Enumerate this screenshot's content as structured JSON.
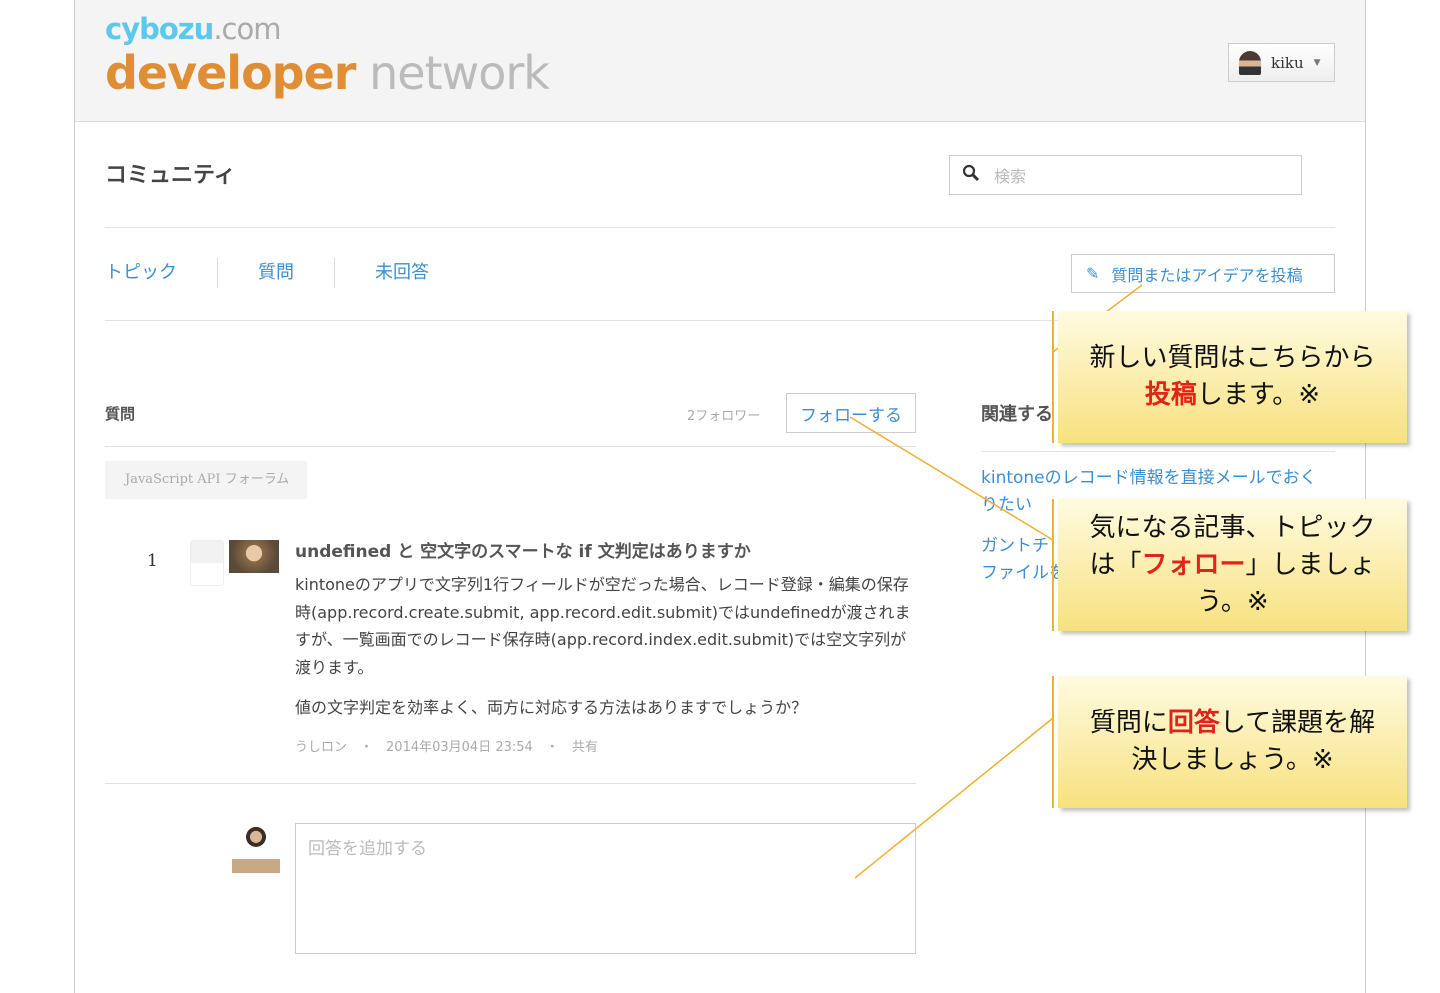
{
  "header": {
    "logo_top_a": "cybozu",
    "logo_top_b": ".com",
    "logo_bottom_a": "developer",
    "logo_bottom_b": " network",
    "user": "kiku"
  },
  "page": {
    "title": "コミュニティ",
    "search_placeholder": "検索"
  },
  "tabs": [
    {
      "label": "トピック"
    },
    {
      "label": "質問"
    },
    {
      "label": "未回答"
    }
  ],
  "post_button": "質問またはアイデアを投稿",
  "question": {
    "section": "質問",
    "followers": "2フォロワー",
    "follow": "フォローする",
    "forum": "JavaScript API フォーラム",
    "votes": "1",
    "title": "undefined と 空文字のスマートな if 文判定はありますか",
    "body1": "kintoneのアプリで文字列1行フィールドが空だった場合、レコード登録・編集の保存時(app.record.create.submit, app.record.edit.submit)ではundefinedが渡されますが、一覧画面でのレコード保存時(app.record.index.edit.submit)では空文字列が渡ります。",
    "body2": "値の文字判定を効率よく、両方に対応する方法はありますでしょうか？",
    "author": "うしロン",
    "date": "2014年03月04日 23:54",
    "share": "共有"
  },
  "answer_placeholder": "回答を追加する",
  "related": {
    "title": "関連する",
    "links": [
      "kintoneのレコード情報を直接メールでおくりたい",
      "ガントチ",
      "ファイルを"
    ]
  },
  "callouts": [
    {
      "pre": "新しい質問はこちらから",
      "em": "投稿",
      "post": "します。※"
    },
    {
      "pre": "気になる記事、トピックは「",
      "em": "フォロー",
      "post": "」しましょう。※"
    },
    {
      "pre": "質問に",
      "em": "回答",
      "post": "して課題を解決しましょう。※"
    }
  ]
}
